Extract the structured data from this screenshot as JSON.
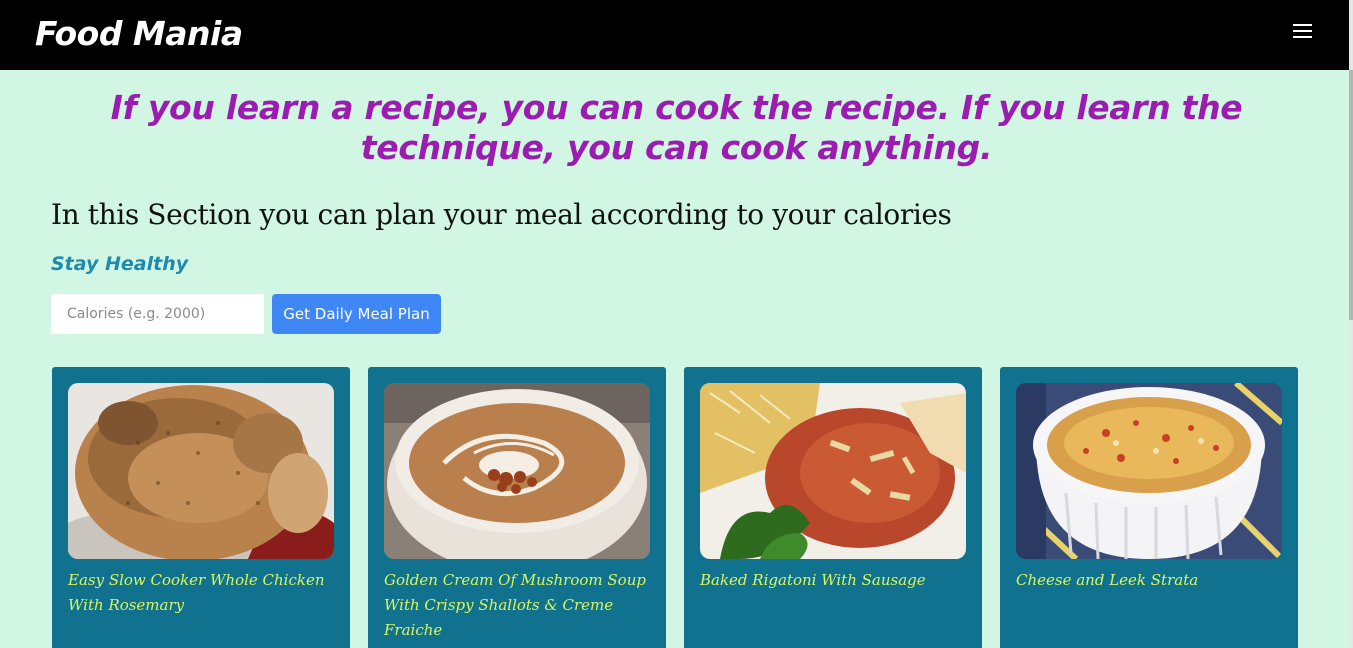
{
  "navbar": {
    "brand": "Food Mania",
    "menu_icon": "hamburger-menu-icon"
  },
  "hero": {
    "quote": "If you learn a recipe, you can cook the recipe. If you learn the technique, you can cook anything."
  },
  "planner": {
    "heading": "In this Section you can plan your meal according to your calories",
    "tagline": "Stay Healthy",
    "calories_placeholder": "Calories (e.g. 2000)",
    "calories_value": "",
    "button_label": "Get Daily Meal Plan"
  },
  "recipes": [
    {
      "title": "Easy Slow Cooker Whole Chicken With Rosemary",
      "image": "roast-chicken"
    },
    {
      "title": "Golden Cream Of Mushroom Soup With Crispy Shallots & Creme Fraiche",
      "image": "mushroom-soup"
    },
    {
      "title": "Baked Rigatoni With Sausage",
      "image": "baked-rigatoni"
    },
    {
      "title": "Cheese and Leek Strata",
      "image": "leek-strata"
    }
  ],
  "colors": {
    "page_background": "#d1f7e4",
    "navbar": "#000000",
    "quote": "#9c1bb1",
    "tagline": "#1e8ab0",
    "button": "#3f87f5",
    "card": "#11728f",
    "card_title": "#d8f55d"
  }
}
